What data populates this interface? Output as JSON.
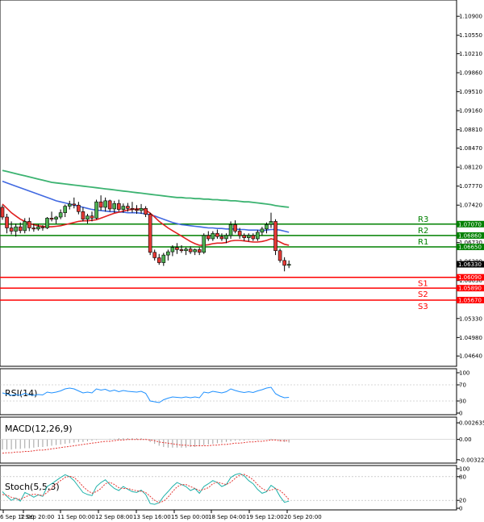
{
  "chart_data": {
    "type": "candlestick",
    "instrument_panel": {
      "y_ticks": [
        "1.10900",
        "1.10550",
        "1.10210",
        "1.09860",
        "1.09510",
        "1.09160",
        "1.08810",
        "1.08470",
        "1.08120",
        "1.07770",
        "1.07420",
        "1.07070",
        "1.06730",
        "1.06380",
        "1.06030",
        "1.05680",
        "1.05330",
        "1.04980",
        "1.04640"
      ],
      "ylim": [
        1.0445,
        1.112
      ],
      "levels": [
        {
          "name": "R3",
          "value": 1.0707,
          "label": "1.07070",
          "color": "#008000"
        },
        {
          "name": "R2",
          "value": 1.0686,
          "label": "1.06860",
          "color": "#008000"
        },
        {
          "name": "R1",
          "value": 1.0665,
          "label": "1.06650",
          "color": "#008000"
        },
        {
          "name": "S1",
          "value": 1.0609,
          "label": "1.06090",
          "color": "#ff0000"
        },
        {
          "name": "S2",
          "value": 1.0589,
          "label": "1.05890",
          "color": "#ff0000"
        },
        {
          "name": "S3",
          "value": 1.0567,
          "label": "1.05670",
          "color": "#ff0000"
        }
      ],
      "current_price": {
        "value": 1.0633,
        "label": "1.06330"
      },
      "candles": [
        {
          "o": 1.0738,
          "h": 1.0742,
          "l": 1.0715,
          "c": 1.072
        },
        {
          "o": 1.072,
          "h": 1.0726,
          "l": 1.069,
          "c": 1.07
        },
        {
          "o": 1.07,
          "h": 1.0712,
          "l": 1.0688,
          "c": 1.0694
        },
        {
          "o": 1.0694,
          "h": 1.0708,
          "l": 1.0684,
          "c": 1.0702
        },
        {
          "o": 1.0702,
          "h": 1.071,
          "l": 1.069,
          "c": 1.0695
        },
        {
          "o": 1.0695,
          "h": 1.0718,
          "l": 1.069,
          "c": 1.0712
        },
        {
          "o": 1.0712,
          "h": 1.0719,
          "l": 1.0694,
          "c": 1.07
        },
        {
          "o": 1.07,
          "h": 1.0708,
          "l": 1.0693,
          "c": 1.0698
        },
        {
          "o": 1.0698,
          "h": 1.0707,
          "l": 1.0695,
          "c": 1.0702
        },
        {
          "o": 1.0702,
          "h": 1.0705,
          "l": 1.0695,
          "c": 1.07
        },
        {
          "o": 1.07,
          "h": 1.072,
          "l": 1.0698,
          "c": 1.0718
        },
        {
          "o": 1.0718,
          "h": 1.073,
          "l": 1.0712,
          "c": 1.0716
        },
        {
          "o": 1.0716,
          "h": 1.0722,
          "l": 1.0708,
          "c": 1.072
        },
        {
          "o": 1.072,
          "h": 1.0734,
          "l": 1.0716,
          "c": 1.0728
        },
        {
          "o": 1.0728,
          "h": 1.0743,
          "l": 1.072,
          "c": 1.074
        },
        {
          "o": 1.074,
          "h": 1.075,
          "l": 1.0734,
          "c": 1.0744
        },
        {
          "o": 1.0744,
          "h": 1.0756,
          "l": 1.0736,
          "c": 1.0742
        },
        {
          "o": 1.0742,
          "h": 1.0748,
          "l": 1.0725,
          "c": 1.073
        },
        {
          "o": 1.073,
          "h": 1.0738,
          "l": 1.0712,
          "c": 1.0716
        },
        {
          "o": 1.0716,
          "h": 1.0726,
          "l": 1.0708,
          "c": 1.0722
        },
        {
          "o": 1.0722,
          "h": 1.073,
          "l": 1.0712,
          "c": 1.0718
        },
        {
          "o": 1.0718,
          "h": 1.0752,
          "l": 1.0716,
          "c": 1.0748
        },
        {
          "o": 1.0748,
          "h": 1.076,
          "l": 1.0732,
          "c": 1.0738
        },
        {
          "o": 1.0738,
          "h": 1.0756,
          "l": 1.073,
          "c": 1.075
        },
        {
          "o": 1.075,
          "h": 1.0752,
          "l": 1.073,
          "c": 1.0735
        },
        {
          "o": 1.0735,
          "h": 1.075,
          "l": 1.0728,
          "c": 1.0745
        },
        {
          "o": 1.0745,
          "h": 1.0752,
          "l": 1.073,
          "c": 1.0734
        },
        {
          "o": 1.0734,
          "h": 1.0745,
          "l": 1.0728,
          "c": 1.074
        },
        {
          "o": 1.074,
          "h": 1.0746,
          "l": 1.073,
          "c": 1.0736
        },
        {
          "o": 1.0736,
          "h": 1.0748,
          "l": 1.0728,
          "c": 1.0734
        },
        {
          "o": 1.0734,
          "h": 1.0742,
          "l": 1.0726,
          "c": 1.0732
        },
        {
          "o": 1.0732,
          "h": 1.0744,
          "l": 1.0726,
          "c": 1.0736
        },
        {
          "o": 1.0736,
          "h": 1.074,
          "l": 1.072,
          "c": 1.0725
        },
        {
          "o": 1.0725,
          "h": 1.0728,
          "l": 1.065,
          "c": 1.0655
        },
        {
          "o": 1.0655,
          "h": 1.066,
          "l": 1.064,
          "c": 1.0645
        },
        {
          "o": 1.0645,
          "h": 1.0652,
          "l": 1.0632,
          "c": 1.0636
        },
        {
          "o": 1.0636,
          "h": 1.0654,
          "l": 1.063,
          "c": 1.065
        },
        {
          "o": 1.065,
          "h": 1.066,
          "l": 1.064,
          "c": 1.0656
        },
        {
          "o": 1.0656,
          "h": 1.0668,
          "l": 1.0648,
          "c": 1.0664
        },
        {
          "o": 1.0664,
          "h": 1.0672,
          "l": 1.0652,
          "c": 1.066
        },
        {
          "o": 1.066,
          "h": 1.0668,
          "l": 1.0654,
          "c": 1.0658
        },
        {
          "o": 1.0658,
          "h": 1.0664,
          "l": 1.065,
          "c": 1.0661
        },
        {
          "o": 1.0661,
          "h": 1.0666,
          "l": 1.0652,
          "c": 1.0656
        },
        {
          "o": 1.0656,
          "h": 1.0662,
          "l": 1.065,
          "c": 1.066
        },
        {
          "o": 1.066,
          "h": 1.0664,
          "l": 1.065,
          "c": 1.0655
        },
        {
          "o": 1.0655,
          "h": 1.069,
          "l": 1.0652,
          "c": 1.0686
        },
        {
          "o": 1.0686,
          "h": 1.0694,
          "l": 1.0676,
          "c": 1.068
        },
        {
          "o": 1.068,
          "h": 1.0694,
          "l": 1.0676,
          "c": 1.069
        },
        {
          "o": 1.069,
          "h": 1.0697,
          "l": 1.068,
          "c": 1.0684
        },
        {
          "o": 1.0684,
          "h": 1.069,
          "l": 1.0676,
          "c": 1.068
        },
        {
          "o": 1.068,
          "h": 1.069,
          "l": 1.0672,
          "c": 1.0686
        },
        {
          "o": 1.0686,
          "h": 1.0712,
          "l": 1.068,
          "c": 1.0706
        },
        {
          "o": 1.0706,
          "h": 1.0714,
          "l": 1.069,
          "c": 1.0694
        },
        {
          "o": 1.0694,
          "h": 1.07,
          "l": 1.068,
          "c": 1.0686
        },
        {
          "o": 1.0686,
          "h": 1.069,
          "l": 1.0676,
          "c": 1.0682
        },
        {
          "o": 1.0682,
          "h": 1.069,
          "l": 1.0675,
          "c": 1.0686
        },
        {
          "o": 1.0686,
          "h": 1.069,
          "l": 1.0676,
          "c": 1.068
        },
        {
          "o": 1.068,
          "h": 1.0696,
          "l": 1.0676,
          "c": 1.0692
        },
        {
          "o": 1.0692,
          "h": 1.0702,
          "l": 1.0686,
          "c": 1.0698
        },
        {
          "o": 1.0698,
          "h": 1.071,
          "l": 1.069,
          "c": 1.0706
        },
        {
          "o": 1.0706,
          "h": 1.0728,
          "l": 1.07,
          "c": 1.0712
        },
        {
          "o": 1.0712,
          "h": 1.0716,
          "l": 1.065,
          "c": 1.0658
        },
        {
          "o": 1.0658,
          "h": 1.0662,
          "l": 1.0636,
          "c": 1.064
        },
        {
          "o": 1.064,
          "h": 1.0646,
          "l": 1.062,
          "c": 1.0631
        },
        {
          "o": 1.0631,
          "h": 1.064,
          "l": 1.0626,
          "c": 1.0633
        }
      ],
      "ma_green": [
        1.0806,
        1.0804,
        1.0802,
        1.08,
        1.0798,
        1.0796,
        1.0794,
        1.0792,
        1.079,
        1.0788,
        1.0786,
        1.0784,
        1.0783,
        1.0782,
        1.0781,
        1.078,
        1.0779,
        1.0778,
        1.0777,
        1.0776,
        1.0775,
        1.0774,
        1.0773,
        1.0772,
        1.0771,
        1.077,
        1.0769,
        1.0768,
        1.0767,
        1.0766,
        1.0765,
        1.0764,
        1.0763,
        1.0762,
        1.0761,
        1.076,
        1.0759,
        1.0758,
        1.0757,
        1.0756,
        1.0756,
        1.0755,
        1.0755,
        1.0754,
        1.0754,
        1.0753,
        1.0753,
        1.0752,
        1.0752,
        1.0751,
        1.0751,
        1.075,
        1.075,
        1.0749,
        1.0748,
        1.0748,
        1.0747,
        1.0746,
        1.0745,
        1.0744,
        1.0743,
        1.0741,
        1.074,
        1.0739,
        1.0738
      ],
      "ma_blue": [
        1.0786,
        1.0783,
        1.078,
        1.0777,
        1.0774,
        1.0771,
        1.0768,
        1.0765,
        1.0762,
        1.0759,
        1.0756,
        1.0753,
        1.075,
        1.0748,
        1.0746,
        1.0744,
        1.0742,
        1.074,
        1.0738,
        1.0736,
        1.0734,
        1.0733,
        1.0732,
        1.0731,
        1.073,
        1.073,
        1.0729,
        1.0729,
        1.0728,
        1.0728,
        1.0728,
        1.0727,
        1.0726,
        1.0724,
        1.0722,
        1.0719,
        1.0716,
        1.0713,
        1.071,
        1.0708,
        1.0706,
        1.0705,
        1.0704,
        1.0703,
        1.0702,
        1.0701,
        1.07,
        1.07,
        1.0699,
        1.0699,
        1.0698,
        1.0698,
        1.0698,
        1.0697,
        1.0697,
        1.0696,
        1.0696,
        1.0696,
        1.0695,
        1.0696,
        1.0697,
        1.0697,
        1.0696,
        1.0694,
        1.0692
      ],
      "ma_red": [
        1.0744,
        1.0736,
        1.0728,
        1.0722,
        1.0716,
        1.0712,
        1.0708,
        1.0706,
        1.0704,
        1.0703,
        1.0702,
        1.0702,
        1.0703,
        1.0704,
        1.0706,
        1.0708,
        1.071,
        1.0712,
        1.0713,
        1.0713,
        1.0714,
        1.0715,
        1.0718,
        1.0721,
        1.0724,
        1.0727,
        1.0729,
        1.0731,
        1.0733,
        1.0734,
        1.0735,
        1.0735,
        1.0733,
        1.0727,
        1.072,
        1.0712,
        1.0706,
        1.07,
        1.0695,
        1.069,
        1.0685,
        1.068,
        1.0675,
        1.0671,
        1.0668,
        1.0668,
        1.0669,
        1.0671,
        1.0672,
        1.0672,
        1.0673,
        1.0676,
        1.0677,
        1.0677,
        1.0676,
        1.0675,
        1.0674,
        1.0674,
        1.0675,
        1.0677,
        1.068,
        1.0678,
        1.0674,
        1.067,
        1.0668
      ]
    },
    "rsi_panel": {
      "label": "RSI(14)",
      "y_ticks": [
        "100",
        "70",
        "30",
        "0"
      ],
      "ylim": [
        0,
        100
      ],
      "values": [
        50,
        47,
        44,
        46,
        44,
        49,
        45,
        44,
        46,
        45,
        52,
        50,
        52,
        55,
        60,
        62,
        60,
        55,
        50,
        52,
        50,
        60,
        57,
        59,
        54,
        57,
        53,
        56,
        54,
        53,
        52,
        54,
        49,
        30,
        28,
        26,
        33,
        37,
        40,
        39,
        38,
        40,
        38,
        40,
        38,
        52,
        50,
        54,
        52,
        50,
        53,
        60,
        56,
        53,
        51,
        53,
        51,
        55,
        58,
        62,
        64,
        48,
        42,
        38,
        39
      ]
    },
    "macd_panel": {
      "label": "MACD(12,26,9)",
      "y_ticks": [
        "0.002635",
        "0.00",
        "-0.00322"
      ],
      "ylim": [
        -0.0035,
        0.0029
      ],
      "hist": [
        -0.0016,
        -0.0016,
        -0.0016,
        -0.0015,
        -0.0015,
        -0.0014,
        -0.0014,
        -0.0013,
        -0.0012,
        -0.0012,
        -0.0011,
        -0.001,
        -0.0009,
        -0.0008,
        -0.0007,
        -0.0006,
        -0.0005,
        -0.0004,
        -0.0004,
        -0.0003,
        -0.0002,
        -0.0001,
        0.0,
        0.0,
        0.0001,
        0.0001,
        0.0002,
        0.0002,
        0.0002,
        0.0002,
        0.0002,
        0.0002,
        0.0001,
        -0.0004,
        -0.0007,
        -0.001,
        -0.0012,
        -0.0013,
        -0.0013,
        -0.0013,
        -0.0013,
        -0.0013,
        -0.0012,
        -0.0012,
        -0.0011,
        -0.0009,
        -0.0008,
        -0.0007,
        -0.0006,
        -0.0005,
        -0.0004,
        -0.0003,
        -0.0002,
        -0.0002,
        -0.0002,
        -0.0001,
        -0.0001,
        -0.0001,
        0.0,
        0.0,
        0.0001,
        -0.0001,
        -0.0003,
        -0.0004,
        -0.0005
      ],
      "signal": [
        -0.0022,
        -0.0021,
        -0.0021,
        -0.002,
        -0.002,
        -0.0019,
        -0.0019,
        -0.0018,
        -0.0017,
        -0.0017,
        -0.0016,
        -0.0015,
        -0.0014,
        -0.0013,
        -0.0012,
        -0.0011,
        -0.001,
        -0.0009,
        -0.0008,
        -0.0007,
        -0.0006,
        -0.0005,
        -0.0004,
        -0.0003,
        -0.0003,
        -0.0002,
        -0.0001,
        -0.0001,
        0.0,
        0.0,
        0.0,
        0.0,
        0.0,
        -0.0001,
        -0.0002,
        -0.0004,
        -0.0005,
        -0.0006,
        -0.0007,
        -0.0008,
        -0.0009,
        -0.0009,
        -0.001,
        -0.001,
        -0.001,
        -0.001,
        -0.001,
        -0.0009,
        -0.0009,
        -0.0008,
        -0.0008,
        -0.0007,
        -0.0006,
        -0.0006,
        -0.0005,
        -0.0004,
        -0.0004,
        -0.0003,
        -0.0003,
        -0.0002,
        -0.0001,
        -0.0001,
        -0.0002,
        -0.0002,
        -0.0002
      ]
    },
    "stoch_panel": {
      "label": "Stoch(5,5,3)",
      "y_ticks": [
        "100",
        "80",
        "20",
        "0"
      ],
      "ylim": [
        0,
        100
      ],
      "k": [
        42,
        30,
        20,
        26,
        18,
        40,
        35,
        28,
        34,
        30,
        55,
        62,
        70,
        78,
        85,
        80,
        70,
        55,
        40,
        35,
        32,
        55,
        65,
        72,
        60,
        50,
        45,
        55,
        48,
        42,
        40,
        46,
        35,
        12,
        10,
        14,
        30,
        42,
        55,
        65,
        60,
        55,
        45,
        50,
        38,
        55,
        62,
        70,
        65,
        55,
        60,
        78,
        85,
        88,
        82,
        70,
        62,
        48,
        38,
        42,
        58,
        50,
        30,
        15,
        18
      ],
      "d": [
        35,
        33,
        28,
        25,
        22,
        28,
        33,
        36,
        34,
        32,
        40,
        50,
        62,
        70,
        78,
        81,
        78,
        68,
        55,
        45,
        38,
        42,
        50,
        62,
        66,
        60,
        52,
        50,
        50,
        47,
        44,
        43,
        40,
        30,
        20,
        14,
        18,
        28,
        42,
        54,
        60,
        60,
        55,
        50,
        45,
        48,
        52,
        62,
        66,
        63,
        60,
        66,
        76,
        84,
        86,
        80,
        72,
        60,
        50,
        44,
        46,
        50,
        45,
        35,
        22
      ]
    },
    "x_ticks": [
      "6 Sep 12:00",
      "7 Sep 20:00",
      "11 Sep 00:00",
      "12 Sep 08:00",
      "13 Sep 16:00",
      "15 Sep 00:00",
      "18 Sep 04:00",
      "19 Sep 12:00",
      "20 Sep 20:00"
    ]
  }
}
